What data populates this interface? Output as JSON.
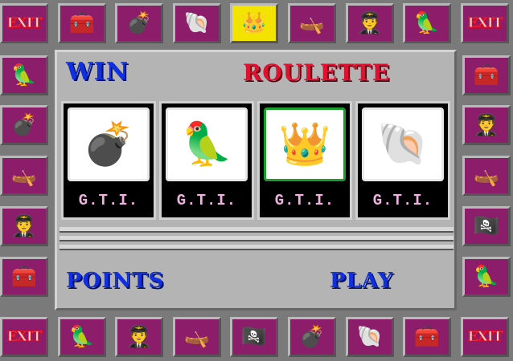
{
  "top_row": [
    {
      "kind": "exit",
      "text": "EXIT"
    },
    {
      "kind": "icon",
      "icon": "treasure-chest-icon",
      "glyph": "🧰"
    },
    {
      "kind": "icon",
      "icon": "cannon-icon",
      "glyph": "💣"
    },
    {
      "kind": "icon",
      "icon": "seashell-icon",
      "glyph": "🐚"
    },
    {
      "kind": "icon",
      "icon": "crown-icon",
      "glyph": "👑",
      "highlight": true
    },
    {
      "kind": "icon",
      "icon": "boat-icon",
      "glyph": "🛶"
    },
    {
      "kind": "icon",
      "icon": "pirate-icon",
      "glyph": "🧑‍✈️"
    },
    {
      "kind": "icon",
      "icon": "parrot-icon",
      "glyph": "🦜"
    },
    {
      "kind": "exit",
      "text": "EXIT"
    }
  ],
  "bottom_row": [
    {
      "kind": "exit",
      "text": "EXIT"
    },
    {
      "kind": "icon",
      "icon": "parrot-icon",
      "glyph": "🦜"
    },
    {
      "kind": "icon",
      "icon": "pirate-icon",
      "glyph": "🧑‍✈️"
    },
    {
      "kind": "icon",
      "icon": "boat-icon",
      "glyph": "🛶"
    },
    {
      "kind": "icon",
      "icon": "pirate-flag-icon",
      "glyph": "🏴‍☠️"
    },
    {
      "kind": "icon",
      "icon": "cannon-icon",
      "glyph": "💣"
    },
    {
      "kind": "icon",
      "icon": "seashell-icon",
      "glyph": "🐚"
    },
    {
      "kind": "icon",
      "icon": "treasure-chest-icon",
      "glyph": "🧰"
    },
    {
      "kind": "exit",
      "text": "EXIT"
    }
  ],
  "left_col": [
    {
      "icon": "parrot-icon",
      "glyph": "🦜"
    },
    {
      "icon": "cannon-icon",
      "glyph": "💣"
    },
    {
      "icon": "boat-icon",
      "glyph": "🛶"
    },
    {
      "icon": "pirate-icon",
      "glyph": "🧑‍✈️"
    },
    {
      "icon": "treasure-chest-icon",
      "glyph": "🧰"
    }
  ],
  "right_col": [
    {
      "icon": "treasure-chest-icon",
      "glyph": "🧰"
    },
    {
      "icon": "pirate-icon",
      "glyph": "🧑‍✈️"
    },
    {
      "icon": "boat-icon",
      "glyph": "🛶"
    },
    {
      "icon": "pirate-flag-icon",
      "glyph": "🏴‍☠️"
    },
    {
      "icon": "parrot-icon",
      "glyph": "🦜"
    }
  ],
  "labels": {
    "win": "WIN",
    "roulette": "ROULETTE",
    "points": "POINTS",
    "play": "PLAY"
  },
  "reels": [
    {
      "icon": "cannon-icon",
      "glyph": "💣",
      "label": "G.T.I.",
      "selected": false
    },
    {
      "icon": "parrot-icon",
      "glyph": "🦜",
      "label": "G.T.I.",
      "selected": false
    },
    {
      "icon": "crown-icon",
      "glyph": "👑",
      "label": "G.T.I.",
      "selected": true
    },
    {
      "icon": "seashell-icon",
      "glyph": "🐚",
      "label": "G.T.I.",
      "selected": false
    }
  ],
  "colors": {
    "tile": "#8b1d6b",
    "highlight": "#f3e400",
    "win_blue": "#1030e0",
    "roulette_red": "#e01030",
    "selected_reel": "#1aa02a"
  }
}
